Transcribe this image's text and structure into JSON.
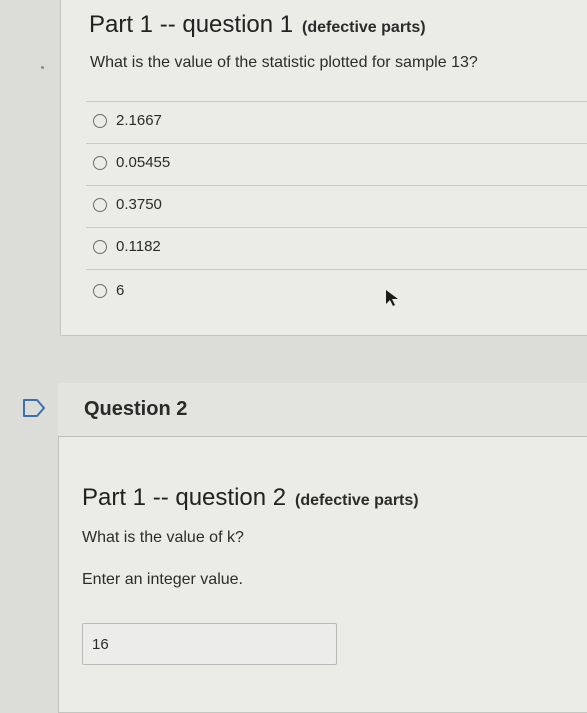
{
  "question1": {
    "title_main": "Part 1 -- question 1",
    "title_suffix": "(defective parts)",
    "prompt": "What is the value of the statistic plotted for sample 13?",
    "options": [
      {
        "label": "2.1667"
      },
      {
        "label": "0.05455"
      },
      {
        "label": "0.3750"
      },
      {
        "label": "0.1182"
      },
      {
        "label": "6"
      }
    ]
  },
  "question2": {
    "heading": "Question 2",
    "title_main": "Part 1 -- question 2",
    "title_suffix": "(defective parts)",
    "prompt": "What is the value of k?",
    "note": "Enter an integer value.",
    "answer_value": "16"
  },
  "icons": {
    "flag": "flag-icon",
    "cursor": "mouse-cursor-icon"
  },
  "colors": {
    "background": "#dcdcd9",
    "card": "#ebebe8",
    "border": "#c3c3bf"
  }
}
